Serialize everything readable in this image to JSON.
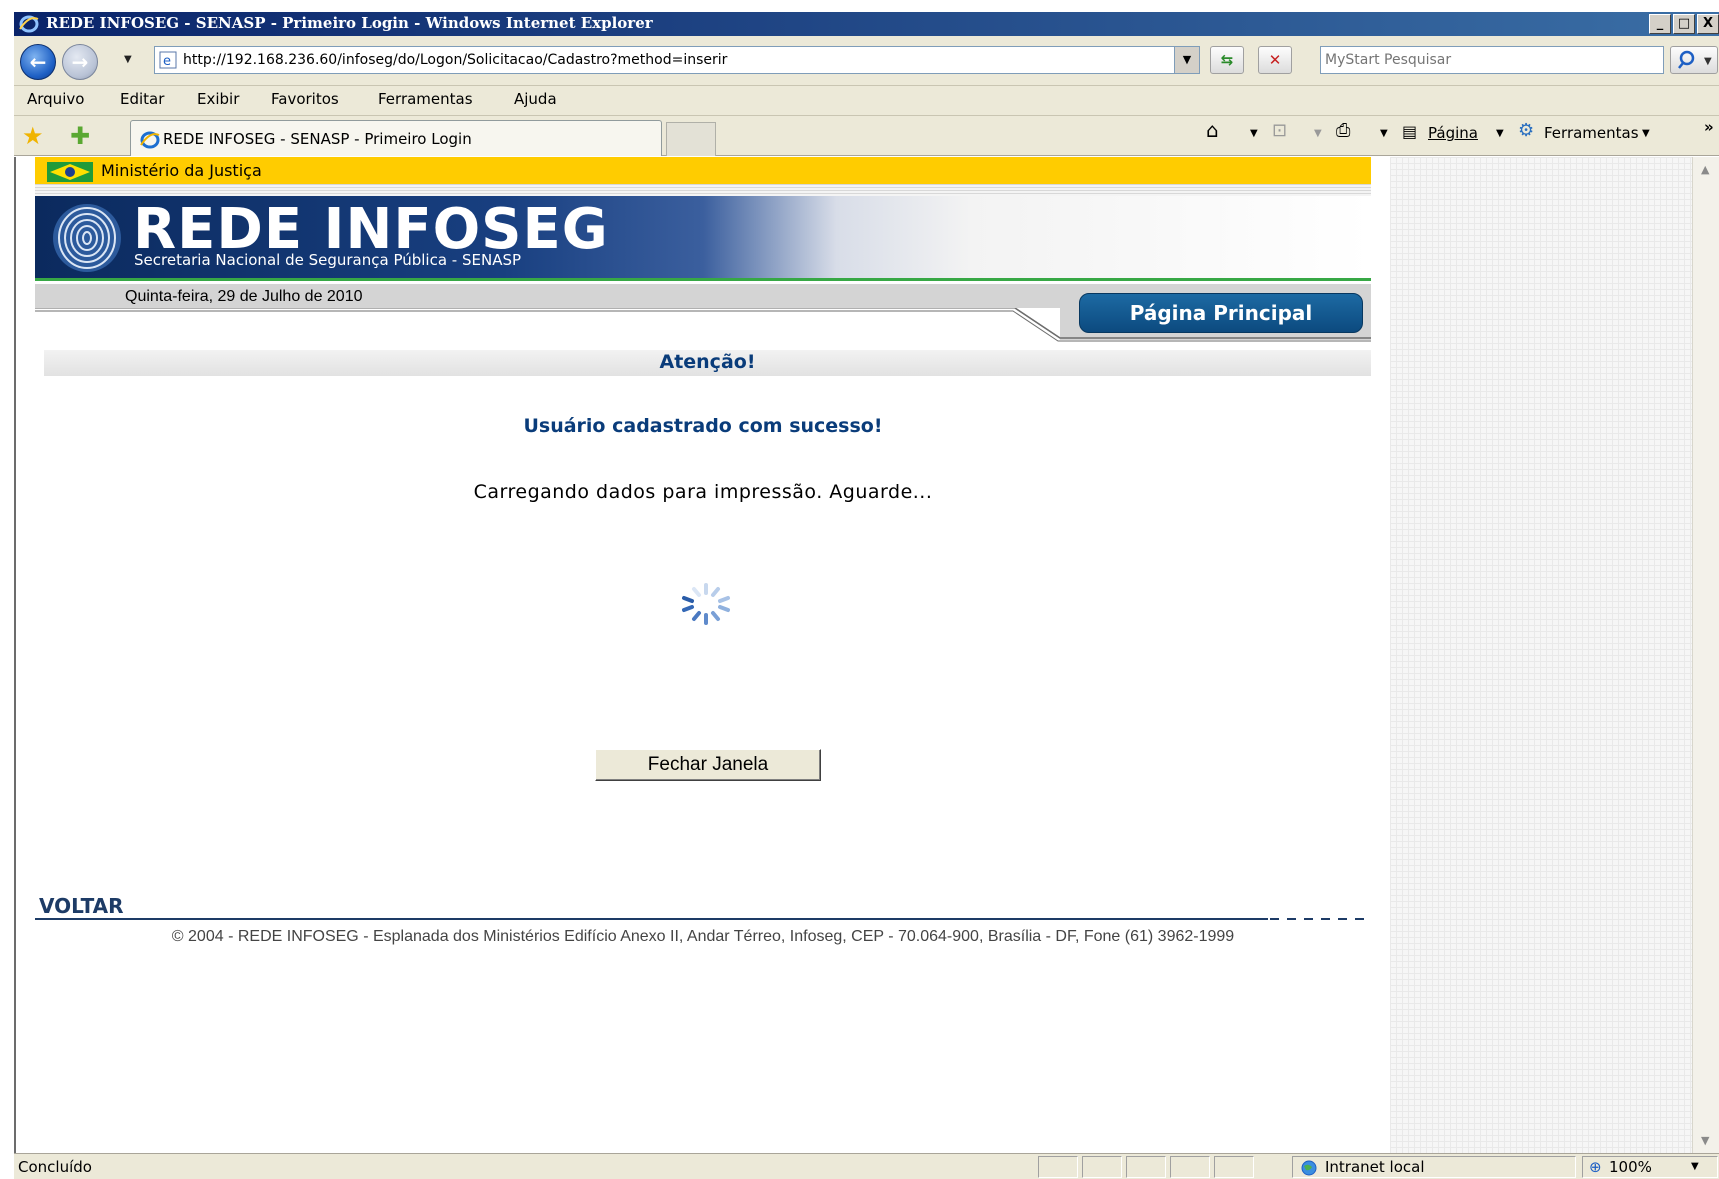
{
  "window": {
    "title": "REDE INFOSEG - SENASP - Primeiro Login - Windows Internet Explorer",
    "minimize": "_",
    "maximize": "□",
    "close": "X"
  },
  "address_bar": {
    "url": "http://192.168.236.60/infoseg/do/Logon/Solicitacao/Cadastro?method=inserir",
    "search_placeholder": "MyStart Pesquisar"
  },
  "menu": {
    "items": [
      "Arquivo",
      "Editar",
      "Exibir",
      "Favoritos",
      "Ferramentas",
      "Ajuda"
    ]
  },
  "tabs": {
    "active_label": "REDE INFOSEG - SENASP - Primeiro Login"
  },
  "command_bar": {
    "page_label": "Página",
    "tools_label": "Ferramentas",
    "more": "»"
  },
  "site": {
    "gov_label": "Ministério da Justiça",
    "brand": "REDE INFOSEG",
    "subtitle": "Secretaria Nacional de Segurança Pública - SENASP",
    "date": "Quinta-feira, 29 de Julho de 2010",
    "main_page_button": "Página Principal",
    "attention": "Atenção!",
    "success_message": "Usuário cadastrado com sucesso!",
    "loading_message": "Carregando dados para impressão. Aguarde...",
    "close_button": "Fechar Janela",
    "back_link": "VOLTAR",
    "footer": "© 2004 - REDE INFOSEG - Esplanada dos Ministérios Edifício Anexo II, Andar Térreo, Infoseg, CEP - 70.064-900, Brasília - DF, Fone (61) 3962-1999"
  },
  "status_bar": {
    "status": "Concluído",
    "zone": "Intranet local",
    "zoom": "100%"
  },
  "colors": {
    "gov_yellow": "#ffcc00",
    "brand_navy": "#0b2a5e",
    "accent_blue": "#0a3c7a",
    "green_line": "#37a845"
  }
}
